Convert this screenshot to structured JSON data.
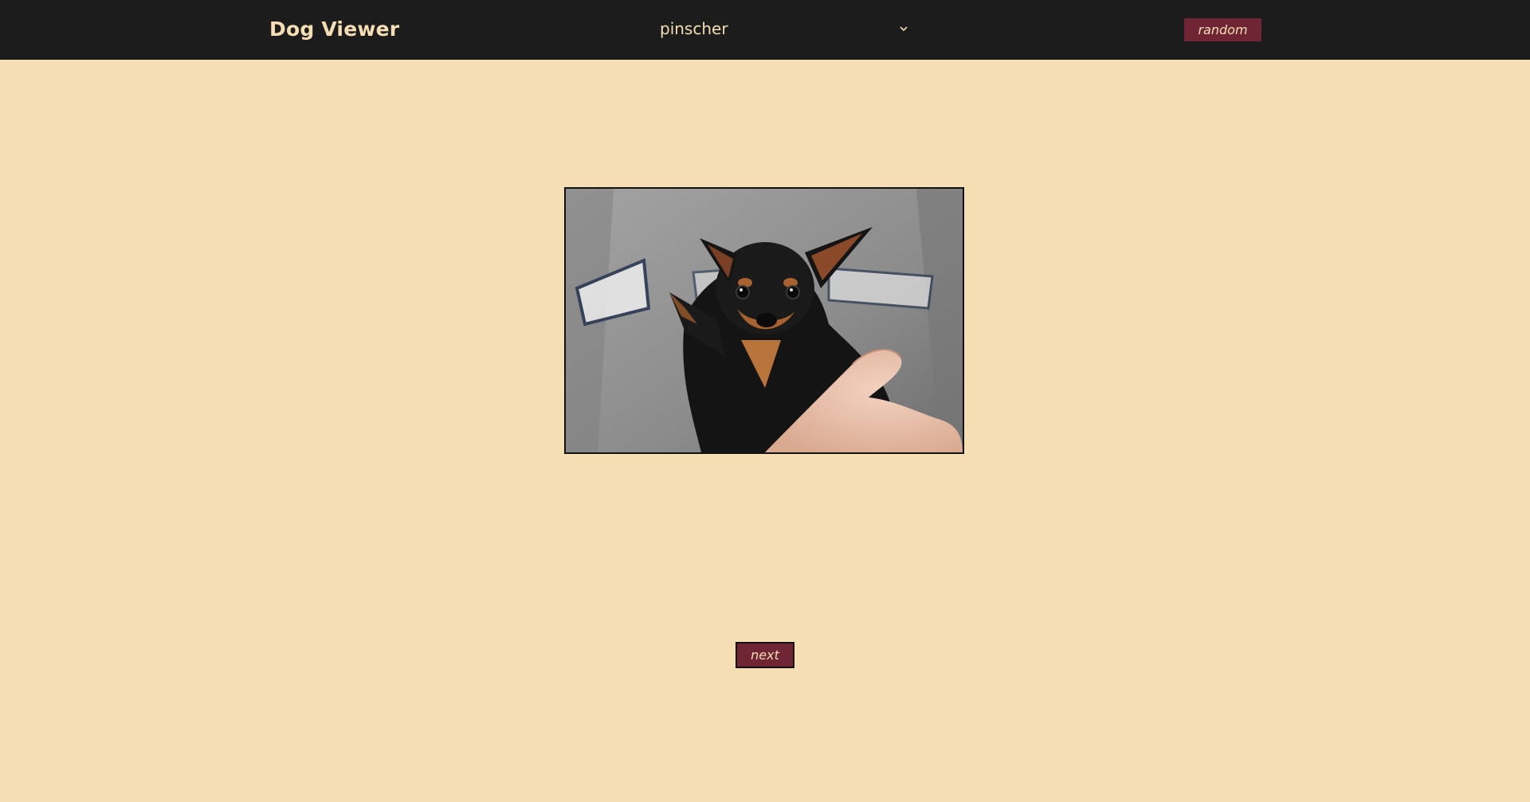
{
  "header": {
    "brand": "Dog Viewer",
    "breed_select": {
      "selected": "pinscher",
      "icon": "chevron-down-icon"
    },
    "random_label": "random"
  },
  "main": {
    "photo": {
      "subject": "dog-photo"
    },
    "next_label": "next"
  },
  "colors": {
    "page_background": "#f5deb3",
    "header_background": "#1c1c1c",
    "accent": "#6f2533",
    "text_light": "#f5deb3"
  }
}
